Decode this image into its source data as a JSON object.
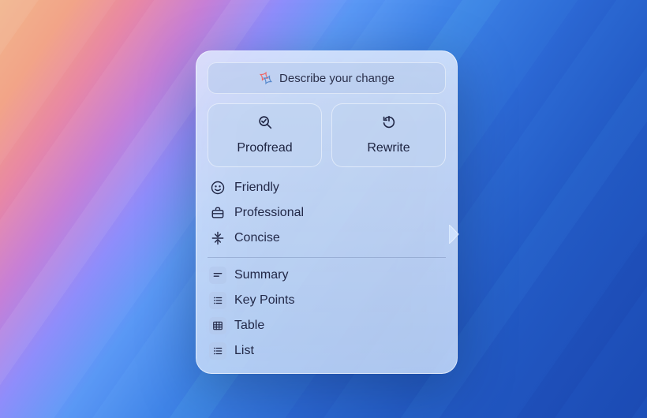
{
  "input": {
    "placeholder": "Describe your change"
  },
  "actions": {
    "proofread": "Proofread",
    "rewrite": "Rewrite"
  },
  "tones": {
    "friendly": "Friendly",
    "professional": "Professional",
    "concise": "Concise"
  },
  "formats": {
    "summary": "Summary",
    "keypoints": "Key Points",
    "table": "Table",
    "list": "List"
  }
}
